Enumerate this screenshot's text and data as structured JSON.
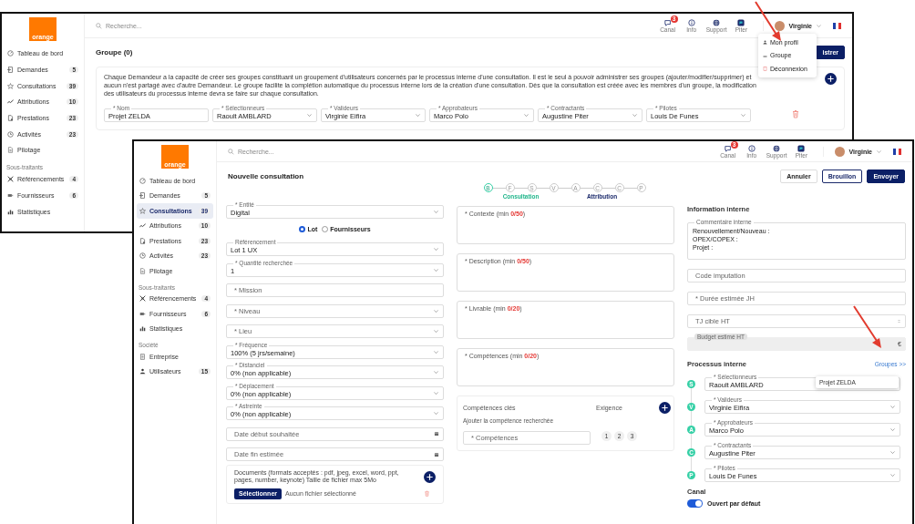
{
  "back_window": {
    "logo": "orange",
    "sidebar": [
      {
        "items": [
          {
            "label": "Tableau de bord",
            "selected": false
          },
          {
            "label": "Demandes",
            "count": "5",
            "selected": false
          },
          {
            "label": "Consultations",
            "count": "39",
            "selected": false
          },
          {
            "label": "Attributions",
            "count": "10",
            "selected": false
          },
          {
            "label": "Prestations",
            "count": "23",
            "selected": false
          },
          {
            "label": "Activités",
            "count": "23",
            "selected": false
          },
          {
            "label": "Pilotage",
            "selected": false
          }
        ]
      },
      {
        "heading": "Sous-traitants",
        "items": [
          {
            "label": "Référencements",
            "count": "4",
            "selected": false
          },
          {
            "label": "Fournisseurs",
            "count": "6",
            "selected": false
          },
          {
            "label": "Statistiques",
            "selected": false
          }
        ]
      }
    ],
    "header": {
      "search_placeholder": "Recherche...",
      "tools": [
        {
          "label": "Canal",
          "badge": "3"
        },
        {
          "label": "Info"
        },
        {
          "label": "Support"
        },
        {
          "label": "Piter"
        }
      ],
      "user": "Virginie"
    },
    "title": "Groupe (0)",
    "save_button": "istrer",
    "user_menu": [
      "Mon profil",
      "Groupe",
      "Déconnexion"
    ],
    "group": {
      "description": "Chaque Demandeur a la capacité de créer ses groupes constituant un groupement d'utilisateurs concernés par le processus interne d'une consultation. Il est le seul à pouvoir administrer ses groupes (ajouter/modifier/supprimer) et aucun n'est partagé avec d'autre Demandeur. Le groupe facilite la complétion automatique du processus interne lors de la création d'une consultation. Dès que la consultation est créée avec les membres d'un groupe, la modification des utilisateurs du processus interne devra se faire sur chaque consultation.",
      "fields": [
        {
          "kind": "input",
          "label": "* Nom",
          "value": "Projet ZELDA"
        },
        {
          "kind": "select",
          "label": "* Sélectionneurs",
          "value": "Raoult AMBLARD"
        },
        {
          "kind": "select",
          "label": "* Valideurs",
          "value": "Virginie Eifira"
        },
        {
          "kind": "select",
          "label": "* Approbateurs",
          "value": "Marco Polo"
        },
        {
          "kind": "select",
          "label": "* Contractants",
          "value": "Augustine Piter"
        },
        {
          "kind": "select",
          "label": "* Pilotes",
          "value": "Louis De Funes"
        }
      ]
    }
  },
  "front_window": {
    "logo": "orange",
    "sidebar": [
      {
        "items": [
          {
            "label": "Tableau de bord",
            "selected": false
          },
          {
            "label": "Demandes",
            "count": "5",
            "selected": false
          },
          {
            "label": "Consultations",
            "count": "39",
            "selected": true
          },
          {
            "label": "Attributions",
            "count": "10",
            "selected": false
          },
          {
            "label": "Prestations",
            "count": "23",
            "selected": false
          },
          {
            "label": "Activités",
            "count": "23",
            "selected": false
          },
          {
            "label": "Pilotage",
            "selected": false
          }
        ]
      },
      {
        "heading": "Sous-traitants",
        "items": [
          {
            "label": "Référencements",
            "count": "4",
            "selected": false
          },
          {
            "label": "Fournisseurs",
            "count": "6",
            "selected": false
          },
          {
            "label": "Statistiques",
            "selected": false
          }
        ]
      },
      {
        "heading": "Société",
        "items": [
          {
            "label": "Entreprise",
            "selected": false
          },
          {
            "label": "Utilisateurs",
            "count": "15",
            "selected": false
          }
        ]
      }
    ],
    "header": {
      "search_placeholder": "Recherche...",
      "tools": [
        {
          "label": "Canal",
          "badge": "3"
        },
        {
          "label": "Info"
        },
        {
          "label": "Support"
        },
        {
          "label": "Piter"
        }
      ],
      "user": "Virginie"
    },
    "title": "Nouvelle consultation",
    "buttons": [
      {
        "label": "Annuler",
        "kind": "default"
      },
      {
        "label": "Brouillon",
        "kind": "outline"
      },
      {
        "label": "Envoyer",
        "kind": "primary"
      }
    ],
    "stepper": [
      {
        "caption": "Consultation",
        "selected": true,
        "steps": [
          {
            "letter": "B",
            "selected": true
          },
          {
            "letter": "F",
            "selected": false
          },
          {
            "letter": "S",
            "selected": false
          },
          {
            "letter": "V",
            "selected": false
          }
        ]
      },
      {
        "caption": "Attribution",
        "selected": false,
        "steps": [
          {
            "letter": "A",
            "selected": false
          },
          {
            "letter": "C",
            "selected": false
          },
          {
            "letter": "C",
            "selected": false
          },
          {
            "letter": "P",
            "selected": false
          }
        ]
      }
    ],
    "form": [
      {
        "kind": "select",
        "label": "* Entité",
        "value": "Digital"
      },
      {
        "kind": "radio",
        "options": [
          {
            "label": "Lot",
            "selected": true
          },
          {
            "label": "Fournisseurs",
            "selected": false
          }
        ]
      },
      {
        "kind": "select",
        "label": "Référencement",
        "value": "Lot 1 UX"
      },
      {
        "kind": "select",
        "label": "* Quantité recherchée",
        "value": "1"
      },
      {
        "kind": "input",
        "placeholder": "* Mission"
      },
      {
        "kind": "select",
        "placeholder": "* Niveau"
      },
      {
        "kind": "select",
        "placeholder": "* Lieu"
      },
      {
        "kind": "select",
        "label": "* Fréquence",
        "value": "100% (5 jrs/semaine)"
      },
      {
        "kind": "select",
        "label": "* Distanciel",
        "value": "0% (non applicable)"
      },
      {
        "kind": "select",
        "label": "* Déplacement",
        "value": "0% (non applicable)"
      },
      {
        "kind": "select",
        "label": "* Astreinte",
        "value": "0% (non applicable)"
      },
      {
        "kind": "date",
        "placeholder": "Date début souhaitée"
      },
      {
        "kind": "date",
        "placeholder": "Date fin estimée"
      }
    ],
    "documents": {
      "text": "Documents (formats acceptés : pdf, jpeg, excel, word, ppt, pages, number, keynote) Taille de fichier max 5Mo",
      "button": "Sélectionner",
      "status": "Aucun fichier sélectionné"
    },
    "textareas": [
      {
        "label": "* Contexte (min ",
        "counter": "0/50",
        "close": ")"
      },
      {
        "label": "* Description (min ",
        "counter": "0/50",
        "close": ")"
      },
      {
        "label": "* Livrable (min ",
        "counter": "0/20",
        "close": ")"
      },
      {
        "label": "* Compétences (min ",
        "counter": "0/20",
        "close": ")"
      }
    ],
    "skills": {
      "title": "Compétences clés",
      "requirement": "Exigence",
      "hint": "Ajouter la compétence recherchée",
      "placeholder": "* Compétences",
      "levels": [
        "1",
        "2",
        "3"
      ]
    },
    "internal": {
      "title": "Information interne",
      "comment": {
        "label": "Commentaire interne",
        "value": "Renouvellement/Nouveau :\nOPEX/COPEX :\nProjet :"
      },
      "fields": [
        {
          "kind": "input",
          "placeholder": "Code imputation"
        },
        {
          "kind": "input",
          "placeholder": "* Durée estimée JH"
        },
        {
          "kind": "number",
          "placeholder": "TJ cible HT"
        },
        {
          "kind": "readonly",
          "label": "Budget estimé HT",
          "suffix": "€"
        }
      ]
    },
    "process": {
      "title": "Processus interne",
      "link": "Groupes >>",
      "steps": [
        {
          "letter": "S",
          "label": "* Sélectionneurs",
          "value": "Raoult AMBLARD"
        },
        {
          "letter": "V",
          "label": "* Valideurs",
          "value": "Virginie Eifira"
        },
        {
          "letter": "A",
          "label": "* Approbateurs",
          "value": "Marco Polo"
        },
        {
          "letter": "C",
          "label": "* Contractants",
          "value": "Augustine Piter"
        },
        {
          "letter": "P",
          "label": "* Pilotes",
          "value": "Louis De Funes"
        }
      ],
      "suggestions": [
        "Projet ZELDA"
      ]
    },
    "channel": {
      "title": "Canal",
      "toggle": {
        "label": "Ouvert par défaut",
        "on": true
      }
    }
  }
}
